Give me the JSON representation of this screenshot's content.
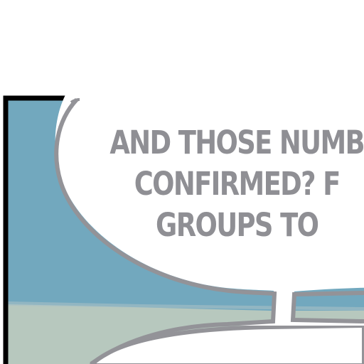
{
  "speech_balloon": {
    "lines": [
      "AND THOSE NUMB",
      "CONFIRMED? F",
      "GROUPS TO"
    ]
  },
  "colors": {
    "sky": "#72a8be",
    "ground": "#b7c8be",
    "panel_border": "#000000",
    "balloon_fill": "#ffffff",
    "balloon_stroke": "#939398",
    "lettering": "#8f8f94"
  }
}
